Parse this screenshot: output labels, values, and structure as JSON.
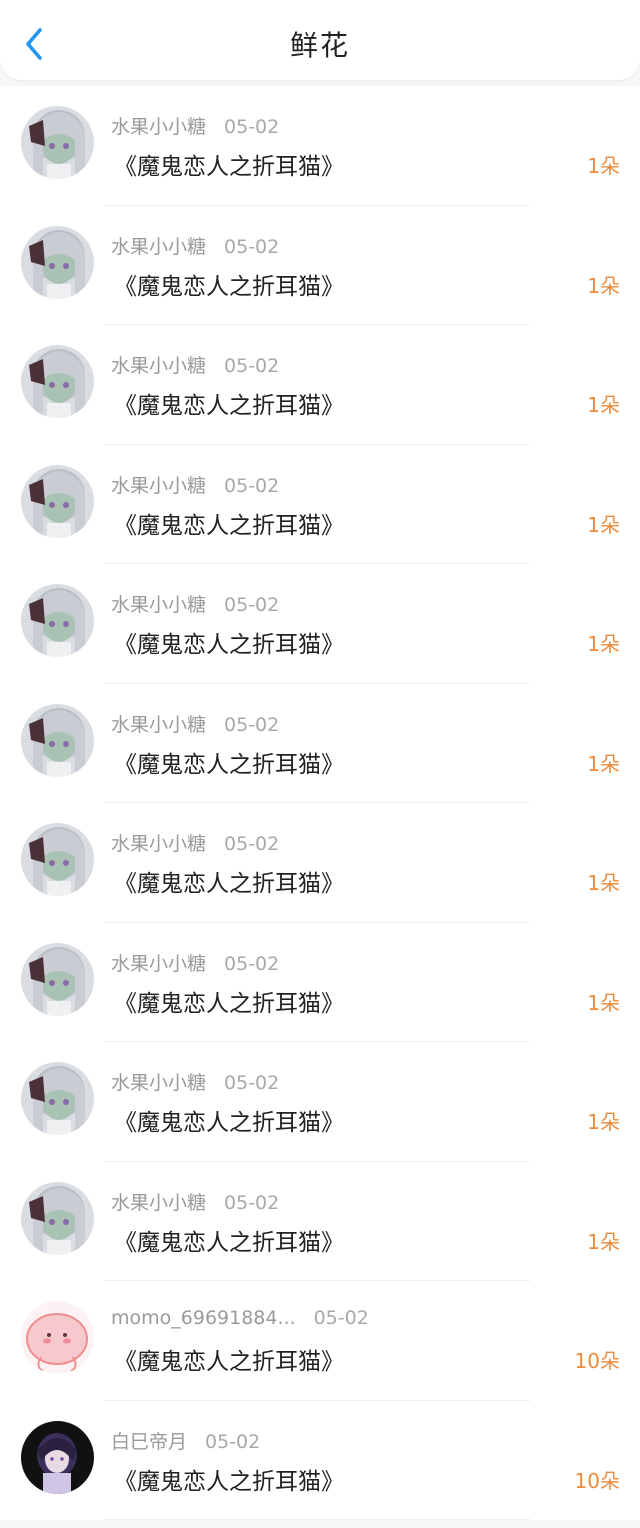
{
  "header": {
    "title": "鲜花",
    "back_icon": "chevron-left-icon"
  },
  "colors": {
    "accent": "#2196f3",
    "count": "#ef8a3c",
    "name": "#9a9a9a",
    "title": "#222222"
  },
  "items": [
    {
      "name": "水果小小糖",
      "date": "05-02",
      "book": "《魔鬼恋人之折耳猫》",
      "count": "1朵",
      "avatar": "gray-hair-girl-avatar"
    },
    {
      "name": "水果小小糖",
      "date": "05-02",
      "book": "《魔鬼恋人之折耳猫》",
      "count": "1朵",
      "avatar": "gray-hair-girl-avatar"
    },
    {
      "name": "水果小小糖",
      "date": "05-02",
      "book": "《魔鬼恋人之折耳猫》",
      "count": "1朵",
      "avatar": "gray-hair-girl-avatar"
    },
    {
      "name": "水果小小糖",
      "date": "05-02",
      "book": "《魔鬼恋人之折耳猫》",
      "count": "1朵",
      "avatar": "gray-hair-girl-avatar"
    },
    {
      "name": "水果小小糖",
      "date": "05-02",
      "book": "《魔鬼恋人之折耳猫》",
      "count": "1朵",
      "avatar": "gray-hair-girl-avatar"
    },
    {
      "name": "水果小小糖",
      "date": "05-02",
      "book": "《魔鬼恋人之折耳猫》",
      "count": "1朵",
      "avatar": "gray-hair-girl-avatar"
    },
    {
      "name": "水果小小糖",
      "date": "05-02",
      "book": "《魔鬼恋人之折耳猫》",
      "count": "1朵",
      "avatar": "gray-hair-girl-avatar"
    },
    {
      "name": "水果小小糖",
      "date": "05-02",
      "book": "《魔鬼恋人之折耳猫》",
      "count": "1朵",
      "avatar": "gray-hair-girl-avatar"
    },
    {
      "name": "水果小小糖",
      "date": "05-02",
      "book": "《魔鬼恋人之折耳猫》",
      "count": "1朵",
      "avatar": "gray-hair-girl-avatar"
    },
    {
      "name": "水果小小糖",
      "date": "05-02",
      "book": "《魔鬼恋人之折耳猫》",
      "count": "1朵",
      "avatar": "gray-hair-girl-avatar"
    },
    {
      "name": "momo_69691884...",
      "date": "05-02",
      "book": "《魔鬼恋人之折耳猫》",
      "count": "10朵",
      "avatar": "pink-blob-avatar"
    },
    {
      "name": "白巳帝月",
      "date": "05-02",
      "book": "《魔鬼恋人之折耳猫》",
      "count": "10朵",
      "avatar": "dark-anime-avatar"
    }
  ]
}
